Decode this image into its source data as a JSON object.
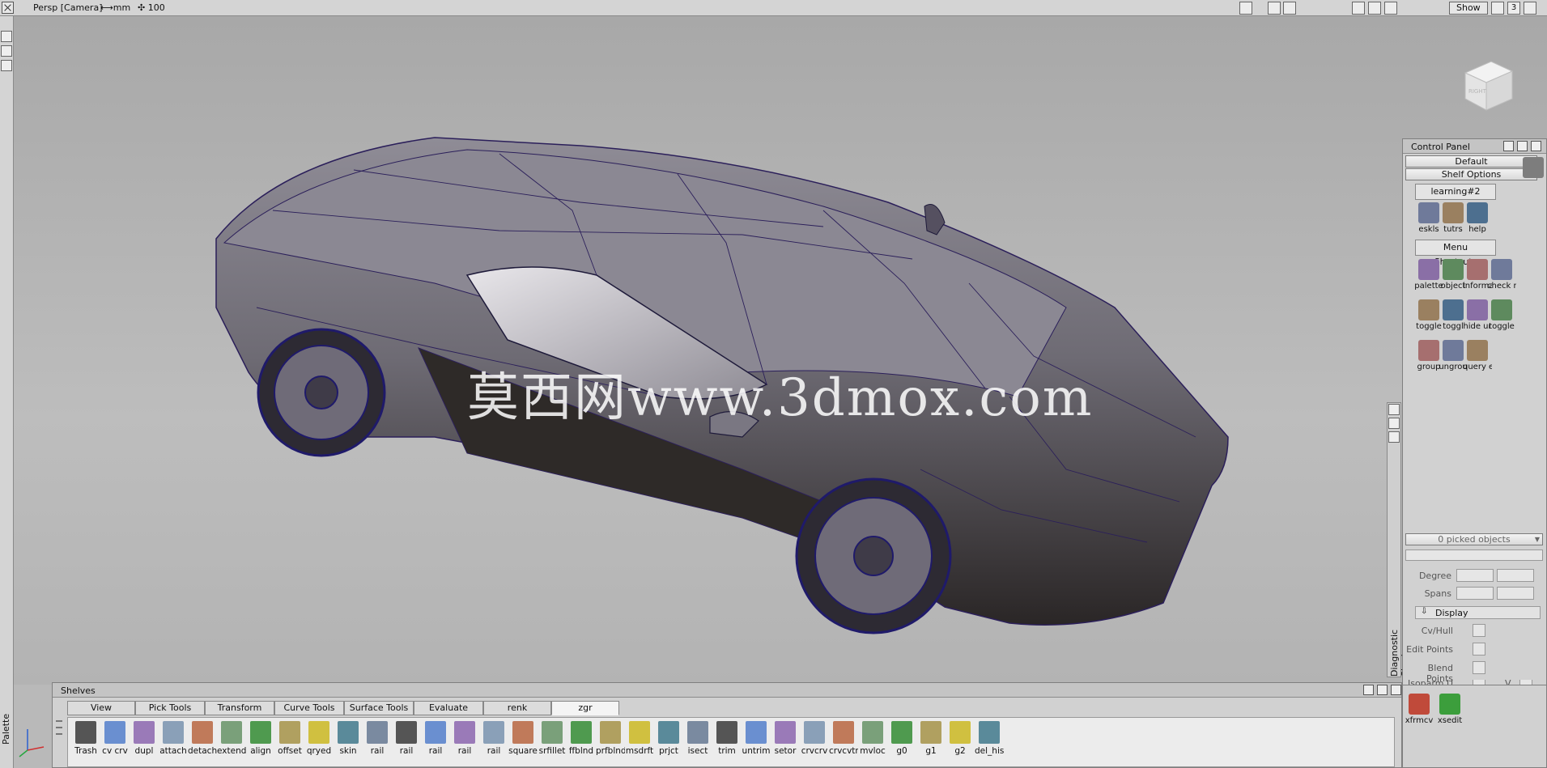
{
  "topbar": {
    "camera": "Persp [Camera]",
    "units": "⟷mm",
    "grid": "✣ 100",
    "show_label": "Show",
    "layout_number": "3"
  },
  "left_strip": {
    "palette_label": "Palette"
  },
  "viewport": {
    "watermark": "莫西网www.3dmox.com",
    "viewcube_face": "RIGHT"
  },
  "control_panel": {
    "title": "Control Panel",
    "shelf_set": "Default",
    "shelf_options": "Shelf Options",
    "tab_learning": "learning#2",
    "tab_menu_shortcuts": "Menu Shortcuts",
    "learning_items": [
      {
        "label": "eskls",
        "icon": "eskls-icon"
      },
      {
        "label": "tutrs",
        "icon": "tutorials-icon"
      },
      {
        "label": "help",
        "icon": "help-icon"
      }
    ],
    "shortcut_items": [
      {
        "label": "palette",
        "icon": "palette-icon"
      },
      {
        "label": "object",
        "icon": "object-icon"
      },
      {
        "label": "informa",
        "icon": "information-icon"
      },
      {
        "label": "check r",
        "icon": "check-icon"
      },
      {
        "label": "toggle",
        "icon": "toggle-icon"
      },
      {
        "label": "toggl",
        "icon": "toggle-icon"
      },
      {
        "label": "hide ur",
        "icon": "hide-icon"
      },
      {
        "label": "toggle",
        "icon": "toggle-icon"
      },
      {
        "label": "group",
        "icon": "group-icon"
      },
      {
        "label": "ungrou",
        "icon": "ungroup-icon"
      },
      {
        "label": "query e",
        "icon": "query-icon"
      }
    ],
    "picked_objects": "0 picked objects",
    "degree_label": "Degree",
    "spans_label": "Spans",
    "display_section": "Display",
    "cv_hull_label": "Cv/Hull",
    "edit_points_label": "Edit Points",
    "blend_points_label": "Blend Points",
    "isoparm_label": "Isoparm U",
    "isoparm_v_label": "V",
    "dock_items": [
      {
        "label": "xfrmcv",
        "icon": "xfrmcv-icon"
      },
      {
        "label": "xsedit",
        "icon": "xsedit-icon"
      }
    ]
  },
  "diagnostic": {
    "label": "Diagnostic Shade"
  },
  "shelves": {
    "title": "Shelves",
    "tabs": [
      "View",
      "Pick Tools",
      "Transform Tools",
      "Curve Tools",
      "Surface Tools",
      "Evaluate",
      "renk",
      "zgr"
    ],
    "active_tab": "zgr",
    "tools": [
      "Trash",
      "cv crv",
      "dupl",
      "attach",
      "detach",
      "extend",
      "align",
      "offset",
      "qryed",
      "skin",
      "rail",
      "rail",
      "rail",
      "rail",
      "rail",
      "square",
      "srfillet",
      "ffblnd",
      "prfblnd",
      "msdrft",
      "prjct",
      "isect",
      "trim",
      "untrim",
      "setor",
      "crvcrv",
      "crvcvtr",
      "mvloc",
      "g0",
      "g1",
      "g2",
      "del_his"
    ]
  }
}
